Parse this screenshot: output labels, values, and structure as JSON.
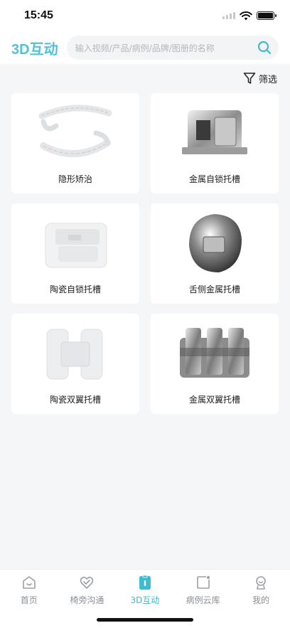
{
  "status_bar": {
    "time": "15:45"
  },
  "header": {
    "title": "3D互动",
    "search_placeholder": "输入视频/产品/病例/品牌/图册的名称",
    "accent_color": "#4fc3d6"
  },
  "filter": {
    "label": "筛选",
    "icon": "filter-icon"
  },
  "cards": [
    {
      "label": "隐形矫治",
      "image": "clear-aligner-image"
    },
    {
      "label": "金属自锁托槽",
      "image": "metal-self-ligating-bracket-image"
    },
    {
      "label": "陶瓷自锁托槽",
      "image": "ceramic-self-ligating-bracket-image"
    },
    {
      "label": "舌侧金属托槽",
      "image": "lingual-metal-bracket-image"
    },
    {
      "label": "陶瓷双翼托槽",
      "image": "ceramic-twin-bracket-image"
    },
    {
      "label": "金属双翼托槽",
      "image": "metal-twin-bracket-image"
    }
  ],
  "tabbar": {
    "items": [
      {
        "label": "首页",
        "icon": "home-icon",
        "active": false
      },
      {
        "label": "椅旁沟通",
        "icon": "heart-chat-icon",
        "active": false
      },
      {
        "label": "3D互动",
        "icon": "3d-interact-icon",
        "active": true
      },
      {
        "label": "病例云库",
        "icon": "case-library-icon",
        "active": false
      },
      {
        "label": "我的",
        "icon": "profile-icon",
        "active": false
      }
    ],
    "active_color": "#3fbad0"
  }
}
